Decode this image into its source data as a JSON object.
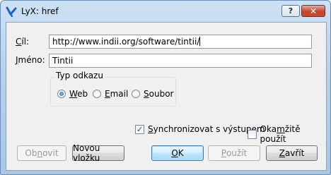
{
  "window": {
    "title": "LyX: href"
  },
  "titlebar": {
    "help_glyph": "?",
    "close_glyph": "✕"
  },
  "form": {
    "target_label_u": "C",
    "target_label_rest": "íl:",
    "target_value": "http://www.indii.org/software/tintii/",
    "name_label_u": "J",
    "name_label_rest": "méno:",
    "name_value": "Tintii"
  },
  "link_type": {
    "title": "Typ odkazu",
    "options": [
      {
        "u": "W",
        "rest": "eb",
        "selected": true
      },
      {
        "u": "E",
        "rest": "mail",
        "selected": false
      },
      {
        "u": "S",
        "rest": "oubor",
        "selected": false
      }
    ]
  },
  "checks": {
    "sync": {
      "u": "S",
      "rest": "ynchronizovat s výstupem",
      "checked": true
    },
    "immediate": {
      "pre": "Oka",
      "u": "m",
      "rest": "žitě použít",
      "checked": false
    }
  },
  "buttons": {
    "restore": {
      "pre": "Ob",
      "u": "n",
      "rest": "ovit"
    },
    "new_inset": {
      "label": "Novou vložku"
    },
    "ok": {
      "u": "O",
      "rest": "K"
    },
    "apply": {
      "u": "P",
      "rest": "oužít"
    },
    "close": {
      "u": "Z",
      "rest": "avřít"
    }
  },
  "colors": {
    "titlebar": "#b9d1ea",
    "client": "#f0f0f0",
    "default_button": "#bee6fd"
  },
  "icons": {
    "app": "lyx-icon",
    "help": "help-icon",
    "close": "close-icon"
  }
}
